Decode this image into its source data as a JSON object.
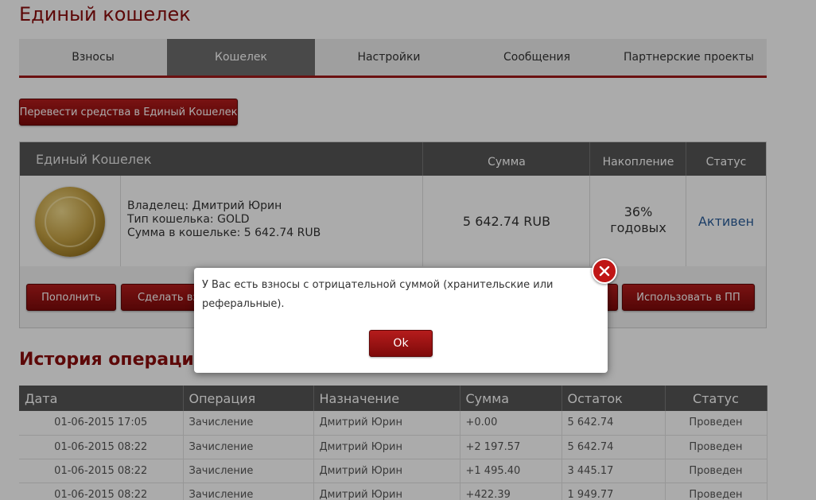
{
  "page": {
    "title": "Единый кошелек"
  },
  "tabs": [
    {
      "label": "Взносы"
    },
    {
      "label": "Кошелек"
    },
    {
      "label": "Настройки"
    },
    {
      "label": "Сообщения"
    },
    {
      "label": "Партнерские проекты"
    }
  ],
  "transfer_button": "Перевести средства в Единый Кошелек",
  "wallet": {
    "title": "Единый Кошелек",
    "columns": {
      "sum": "Сумма",
      "accumulation": "Накопление",
      "status": "Статус"
    },
    "owner_line": "Владелец: Дмитрий Юрин",
    "type_line": "Тип кошелька: GOLD",
    "balance_line": "Сумма в кошельке: 5 642.74 RUB",
    "sum": "5 642.74 RUB",
    "accumulation_value": "36%",
    "accumulation_unit": "годовых",
    "status": "Активен",
    "actions": {
      "replenish": "Пополнить",
      "make": "Сделать вз",
      "use_pp": "Использовать в ПП"
    }
  },
  "history": {
    "title": "История операци",
    "columns": [
      "Дата",
      "Операция",
      "Назначение",
      "Сумма",
      "Остаток",
      "Статус"
    ],
    "rows": [
      [
        "01-06-2015 17:05",
        "Зачисление",
        "Дмитрий Юрин",
        "+0.00",
        "5 642.74",
        "Проведен"
      ],
      [
        "01-06-2015 08:22",
        "Зачисление",
        "Дмитрий Юрин",
        "+2 197.57",
        "5 642.74",
        "Проведен"
      ],
      [
        "01-06-2015 08:22",
        "Зачисление",
        "Дмитрий Юрин",
        "+1 495.40",
        "3 445.17",
        "Проведен"
      ],
      [
        "01-06-2015 08:22",
        "Зачисление",
        "Дмитрий Юрин",
        "+422.39",
        "1 949.77",
        "Проведен"
      ]
    ]
  },
  "dialog": {
    "message": "У Вас есть взносы с отрицательной суммой (хранительские или реферальные).",
    "ok": "Ok",
    "close_icon": "close-icon"
  },
  "colors": {
    "brand_red": "#8b0d0d",
    "header_gray": "#555555",
    "active_tab": "#6d6d6d",
    "status_blue": "#2a5d9a"
  }
}
